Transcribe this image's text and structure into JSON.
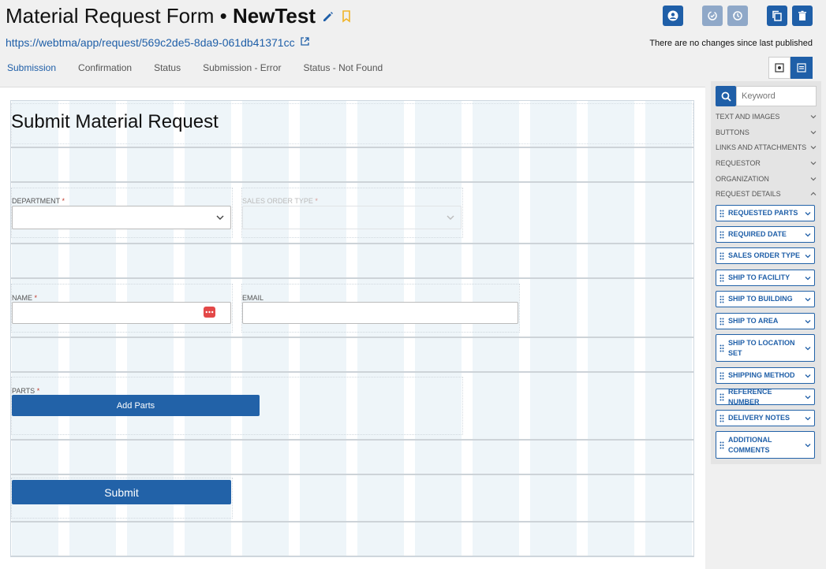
{
  "header": {
    "title_prefix": "Material Request Form •",
    "title_name": "NewTest",
    "url": "https://webtma/app/request/569c2de5-8da9-061db41371cc",
    "publish_status": "There are no changes since last published"
  },
  "tabs": [
    {
      "label": "Submission",
      "active": true
    },
    {
      "label": "Confirmation"
    },
    {
      "label": "Status"
    },
    {
      "label": "Submission - Error"
    },
    {
      "label": "Status - Not Found"
    }
  ],
  "form": {
    "title": "Submit Material Request",
    "department_label": "DEPARTMENT",
    "sales_order_type_label": "SALES ORDER TYPE",
    "name_label": "NAME",
    "email_label": "EMAIL",
    "parts_label": "PARTS",
    "required_mark": "*",
    "add_parts_label": "Add Parts",
    "submit_label": "Submit"
  },
  "palette": {
    "search_placeholder": "Keyword",
    "categories": [
      "TEXT AND IMAGES",
      "BUTTONS",
      "LINKS AND ATTACHMENTS",
      "REQUESTOR",
      "ORGANIZATION",
      "REQUEST DETAILS"
    ],
    "items": [
      "REQUESTED PARTS",
      "REQUIRED DATE",
      "SALES ORDER TYPE",
      "SHIP TO FACILITY",
      "SHIP TO BUILDING",
      "SHIP TO AREA",
      "SHIP TO LOCATION SET",
      "SHIPPING METHOD",
      "REFERENCE NUMBER",
      "DELIVERY NOTES",
      "ADDITIONAL COMMENTS"
    ]
  },
  "colors": {
    "accent": "#1f5fa8",
    "button": "#2262a8",
    "required": "#c0392b",
    "grid_column": "#eef5f9"
  }
}
